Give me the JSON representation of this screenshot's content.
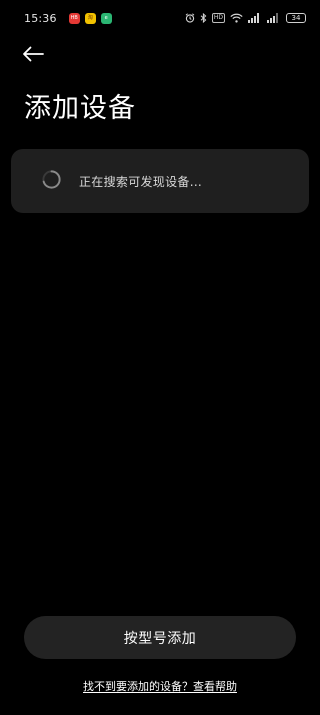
{
  "status_bar": {
    "time": "15:36",
    "app_icons": [
      {
        "name": "red-app-icon",
        "color": "#e53935",
        "label": "HB"
      },
      {
        "name": "yellow-app-icon",
        "color": "#f2c200",
        "label": "淘"
      },
      {
        "name": "green-app-icon",
        "color": "#2bb673",
        "label": "e"
      }
    ],
    "hd_label": "HD",
    "battery": "34"
  },
  "header": {
    "title": "添加设备"
  },
  "search_card": {
    "status_text": "正在搜索可发现设备..."
  },
  "footer": {
    "add_by_model_label": "按型号添加",
    "help_text": "找不到要添加的设备？查看帮助"
  },
  "colors": {
    "background": "#000000",
    "card": "#1f1f1f",
    "button": "#232323"
  }
}
